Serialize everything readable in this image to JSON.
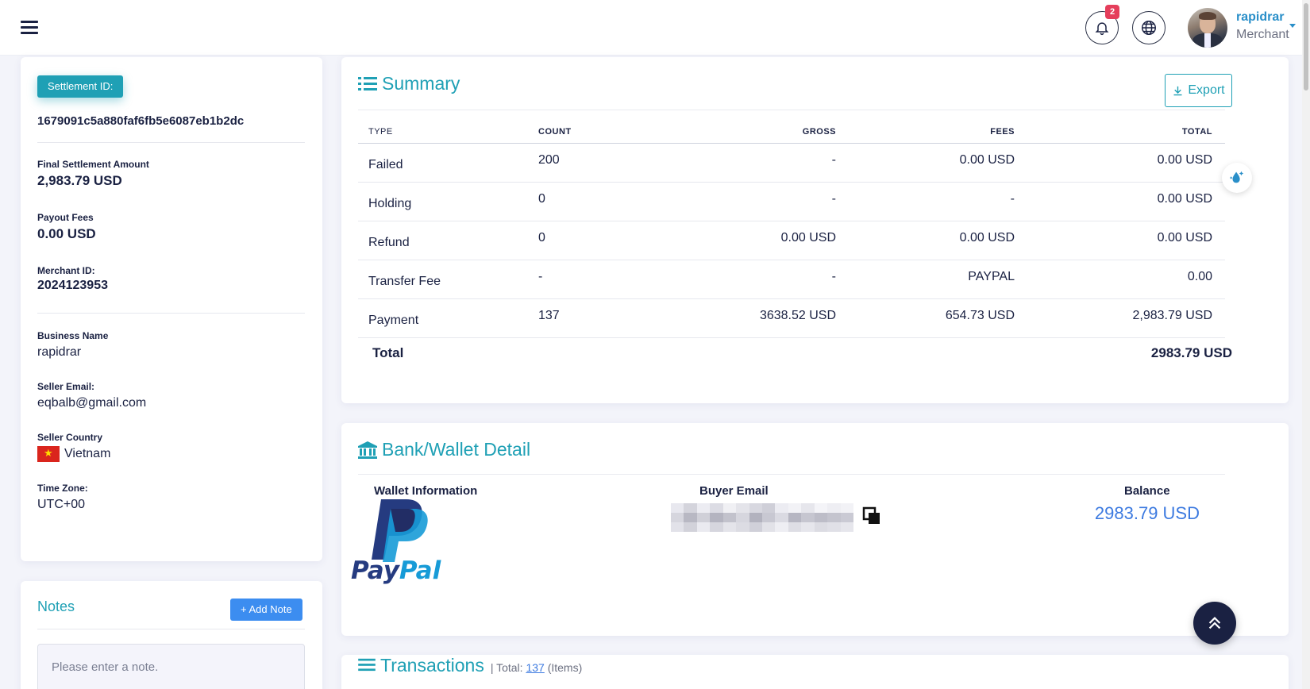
{
  "header": {
    "notification_count": "2",
    "user": {
      "name": "rapidrar",
      "role": "Merchant"
    }
  },
  "settlement": {
    "id_button": "Settlement ID:",
    "id_value": "1679091c5a880faf6fb5e6087eb1b2dc",
    "final_amount_label": "Final Settlement Amount",
    "final_amount_value": "2,983.79 USD",
    "payout_fees_label": "Payout Fees",
    "payout_fees_value": "0.00 USD",
    "merchant_id_label": "Merchant ID:",
    "merchant_id_value": "2024123953",
    "business_name_label": "Business Name",
    "business_name_value": "rapidrar",
    "seller_email_label": "Seller Email:",
    "seller_email_value": "eqbalb@gmail.com",
    "seller_country_label": "Seller Country",
    "seller_country_value": "Vietnam",
    "timezone_label": "Time Zone:",
    "timezone_value": "UTC+00"
  },
  "notes": {
    "title": "Notes",
    "add_button": "+ Add Note",
    "placeholder": "Please enter a note."
  },
  "summary": {
    "title": "Summary",
    "export_label": "Export",
    "columns": [
      "TYPE",
      "COUNT",
      "GROSS",
      "FEES",
      "TOTAL"
    ],
    "rows": [
      [
        "Failed",
        "200",
        "-",
        "0.00 USD",
        "0.00 USD"
      ],
      [
        "Holding",
        "0",
        "-",
        "-",
        "0.00 USD"
      ],
      [
        "Refund",
        "0",
        "0.00 USD",
        "0.00 USD",
        "0.00 USD"
      ],
      [
        "Transfer Fee",
        "-",
        "-",
        "PAYPAL",
        "0.00"
      ],
      [
        "Payment",
        "137",
        "3638.52 USD",
        "654.73 USD",
        "2,983.79 USD"
      ]
    ],
    "total_label": "Total",
    "total_value": "2983.79 USD"
  },
  "bank": {
    "title": "Bank/Wallet Detail",
    "wallet_label": "Wallet Information",
    "buyer_email_label": "Buyer Email",
    "balance_label": "Balance",
    "balance_value": "2983.79 USD",
    "wallet_logo_text_1": "Pay",
    "wallet_logo_text_2": "Pal"
  },
  "transactions": {
    "title": "Transactions",
    "total_prefix": "| Total:",
    "total_count": "137",
    "total_suffix": "(Items)"
  },
  "colors": {
    "accent": "#1fa0b5",
    "link": "#3c7ae0",
    "badge": "#e53e5b",
    "dark": "#1a2142"
  }
}
